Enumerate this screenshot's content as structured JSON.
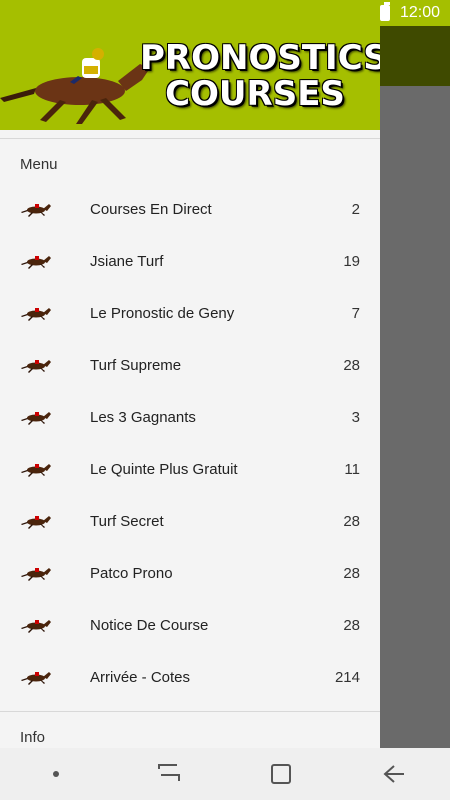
{
  "status": {
    "time": "12:00",
    "battery_icon": "battery-icon"
  },
  "header": {
    "brand_line1": "PRONOSTICS",
    "brand_line2": "COURSES",
    "accent": "#a5bf00"
  },
  "menu": {
    "title": "Menu",
    "items": [
      {
        "label": "Courses En Direct",
        "count": "2",
        "icon": "horse-icon"
      },
      {
        "label": "Jsiane Turf",
        "count": "19",
        "icon": "horse-icon"
      },
      {
        "label": "Le Pronostic de Geny",
        "count": "7",
        "icon": "horse-icon"
      },
      {
        "label": "Turf Supreme",
        "count": "28",
        "icon": "horse-icon"
      },
      {
        "label": "Les 3 Gagnants",
        "count": "3",
        "icon": "horse-icon"
      },
      {
        "label": "Le Quinte Plus Gratuit",
        "count": "11",
        "icon": "horse-icon"
      },
      {
        "label": "Turf Secret",
        "count": "28",
        "icon": "horse-icon"
      },
      {
        "label": "Patco Prono",
        "count": "28",
        "icon": "horse-icon"
      },
      {
        "label": "Notice De Course",
        "count": "28",
        "icon": "horse-icon"
      },
      {
        "label": "Arrivée - Cotes",
        "count": "214",
        "icon": "horse-icon"
      }
    ]
  },
  "info": {
    "title": "Info"
  },
  "navbar": {
    "icons": [
      "dot-icon",
      "recents-icon",
      "home-icon",
      "back-icon"
    ]
  }
}
